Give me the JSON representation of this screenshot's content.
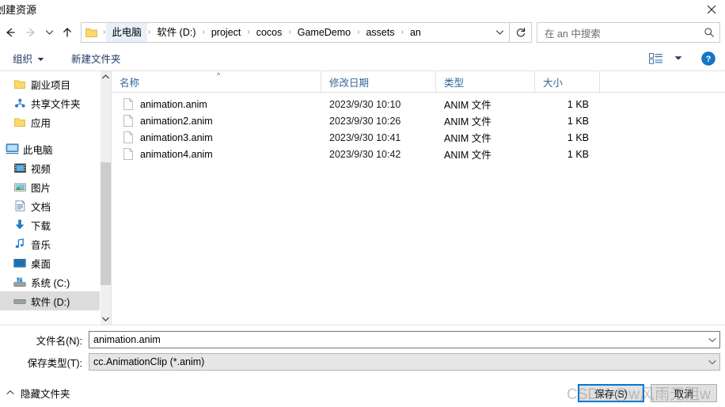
{
  "window": {
    "title": "创建资源",
    "close_icon": "close-icon"
  },
  "nav": {
    "back_icon": "arrow-left-icon",
    "forward_icon": "arrow-right-icon",
    "recent_icon": "chevron-down-icon",
    "up_icon": "arrow-up-icon",
    "refresh_icon": "refresh-icon",
    "address_folder_icon": "folder-icon",
    "address_chevron_icon": "chevron-down-icon",
    "breadcrumbs": [
      "此电脑",
      "软件 (D:)",
      "project",
      "cocos",
      "GameDemo",
      "assets",
      "an"
    ],
    "separator": "›"
  },
  "search": {
    "placeholder": "在 an 中搜索",
    "icon": "search-icon"
  },
  "toolbar": {
    "organize_label": "组织",
    "organize_caret": "▼",
    "new_folder_label": "新建文件夹",
    "view_icon": "view-options-icon",
    "view_caret": "▼",
    "help_icon": "help-icon",
    "help_glyph": "?"
  },
  "sidebar": {
    "items": [
      {
        "label": "副业项目",
        "icon": "folder-icon",
        "selected": false
      },
      {
        "label": "共享文件夹",
        "icon": "shared-folder-icon",
        "selected": false
      },
      {
        "label": "应用",
        "icon": "folder-icon",
        "selected": false
      },
      {
        "label": "此电脑",
        "icon": "this-pc-icon",
        "selected": false
      },
      {
        "label": "视频",
        "icon": "videos-icon",
        "selected": false
      },
      {
        "label": "图片",
        "icon": "pictures-icon",
        "selected": false
      },
      {
        "label": "文档",
        "icon": "documents-icon",
        "selected": false
      },
      {
        "label": "下载",
        "icon": "downloads-icon",
        "selected": false
      },
      {
        "label": "音乐",
        "icon": "music-icon",
        "selected": false
      },
      {
        "label": "桌面",
        "icon": "desktop-icon",
        "selected": false
      },
      {
        "label": "系统 (C:)",
        "icon": "system-drive-icon",
        "selected": false
      },
      {
        "label": "软件 (D:)",
        "icon": "drive-icon",
        "selected": true
      }
    ],
    "scroll_up_icon": "chevron-up-icon",
    "scroll_down_icon": "chevron-down-icon"
  },
  "filelist": {
    "columns": [
      {
        "key": "name",
        "label": "名称",
        "sorted": "asc",
        "sort_glyph": "^"
      },
      {
        "key": "date",
        "label": "修改日期"
      },
      {
        "key": "type",
        "label": "类型"
      },
      {
        "key": "size",
        "label": "大小"
      }
    ],
    "rows": [
      {
        "icon": "file-icon",
        "name": "animation.anim",
        "date": "2023/9/30 10:10",
        "type": "ANIM 文件",
        "size": "1 KB"
      },
      {
        "icon": "file-icon",
        "name": "animation2.anim",
        "date": "2023/9/30 10:26",
        "type": "ANIM 文件",
        "size": "1 KB"
      },
      {
        "icon": "file-icon",
        "name": "animation3.anim",
        "date": "2023/9/30 10:41",
        "type": "ANIM 文件",
        "size": "1 KB"
      },
      {
        "icon": "file-icon",
        "name": "animation4.anim",
        "date": "2023/9/30 10:42",
        "type": "ANIM 文件",
        "size": "1 KB"
      }
    ]
  },
  "form": {
    "filename_label": "文件名(N):",
    "filename_value": "animation.anim",
    "filetype_label": "保存类型(T):",
    "filetype_value": "cc.AnimationClip (*.anim)",
    "chevron_icon": "chevron-down-icon"
  },
  "footer": {
    "hide_folders_label": "隐藏文件夹",
    "hide_folders_chevron": "⌃",
    "save_label": "保存(S)",
    "cancel_label": "取消"
  },
  "watermark": {
    "text": "CSDN @w风雨无阻w"
  },
  "colors": {
    "accent": "#0078d7",
    "header_text": "#33669a",
    "toolbar_text": "#1f3864",
    "selection": "#dcdcdc",
    "crumb_highlight": "#e8f1fa",
    "folder_yellow": "#ffd966"
  }
}
